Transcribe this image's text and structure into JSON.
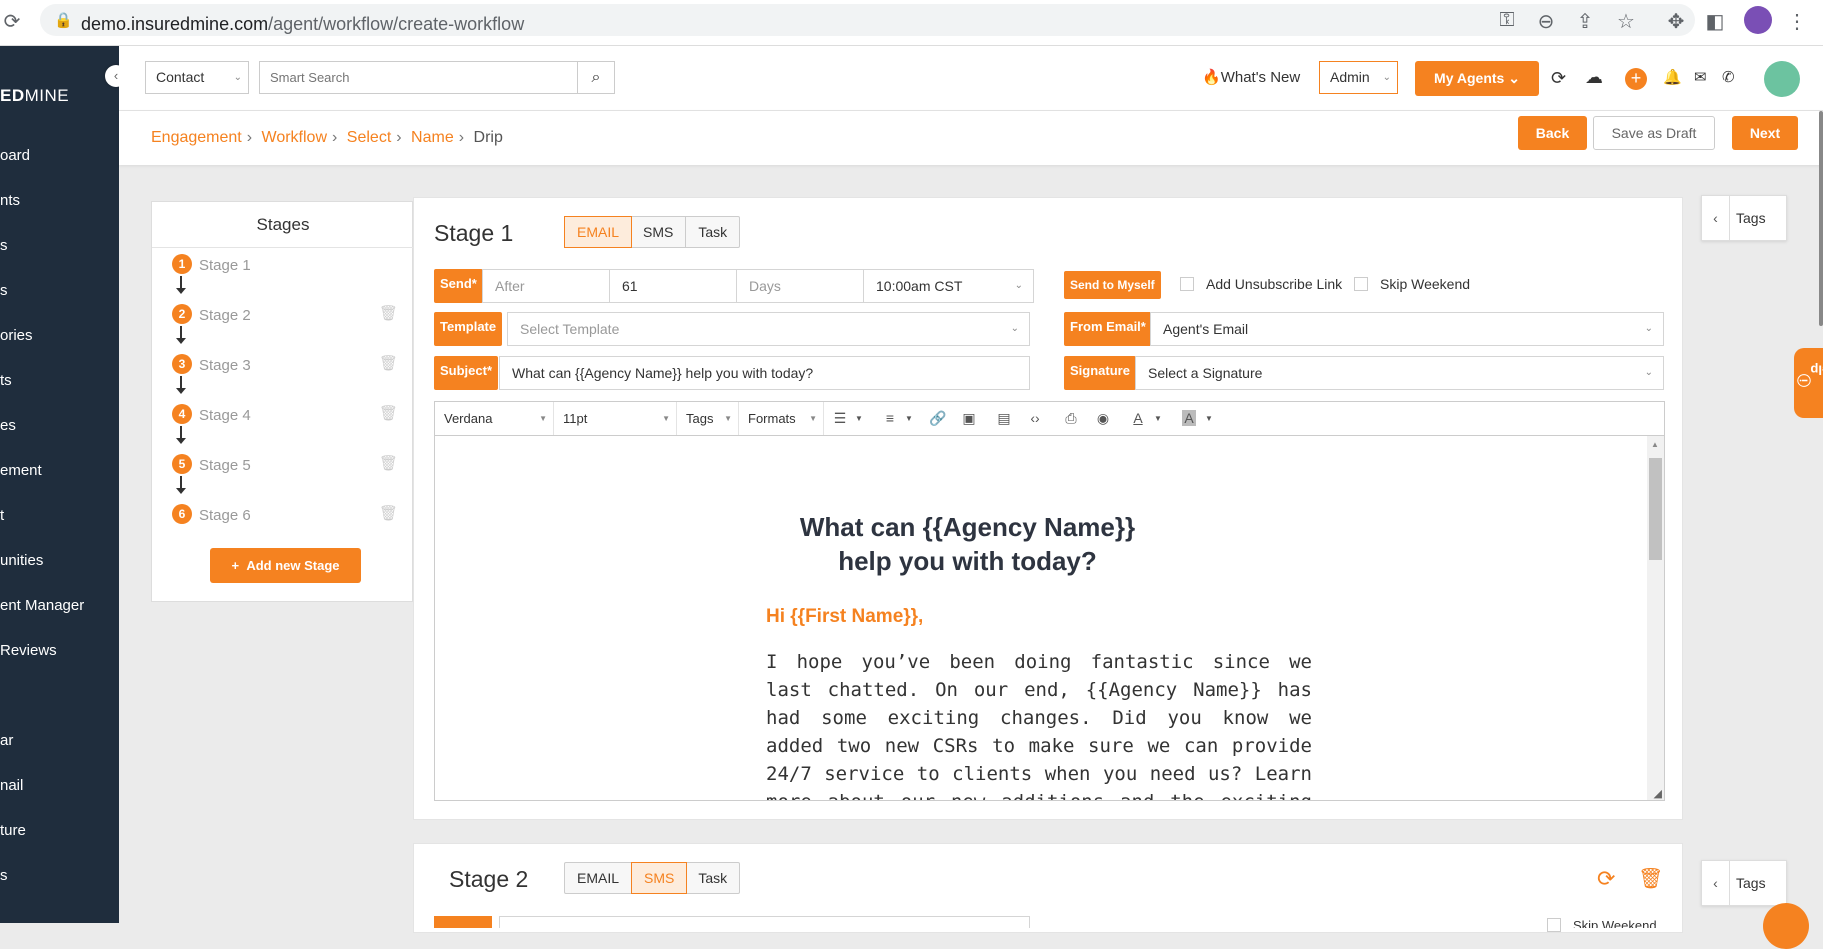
{
  "browser": {
    "url_host": "demo.insuredmine.com",
    "url_path": "/agent/workflow/create-workflow"
  },
  "sidebar": {
    "logo_bold": "ED",
    "logo_rest": "MINE",
    "items": [
      "oard",
      "nts",
      "s",
      "s",
      "ories",
      "ts",
      "es",
      "ement",
      "t",
      "unities",
      "ent Manager",
      "Reviews",
      "ar",
      "nail",
      "ture",
      "s"
    ]
  },
  "topbar": {
    "contact_select": "Contact",
    "search_placeholder": "Smart Search",
    "whats_new": "What's New",
    "admin_select": "Admin",
    "my_agents": "My Agents",
    "plus": "+"
  },
  "breadcrumb": {
    "items": [
      "Engagement",
      "Workflow",
      "Select",
      "Name"
    ],
    "current": "Drip"
  },
  "actions": {
    "back": "Back",
    "save_draft": "Save as Draft",
    "next": "Next"
  },
  "stages_panel": {
    "title": "Stages",
    "stages": [
      {
        "num": "1",
        "name": "Stage 1"
      },
      {
        "num": "2",
        "name": "Stage 2"
      },
      {
        "num": "3",
        "name": "Stage 3"
      },
      {
        "num": "4",
        "name": "Stage 4"
      },
      {
        "num": "5",
        "name": "Stage 5"
      },
      {
        "num": "6",
        "name": "Stage 6"
      }
    ],
    "add_button": "Add new Stage",
    "add_icon": "+"
  },
  "stage1": {
    "title": "Stage 1",
    "tabs": [
      "EMAIL",
      "SMS",
      "Task"
    ],
    "active_tab": "EMAIL",
    "send_label": "Send*",
    "after_placeholder": "After",
    "days_value": "61",
    "days_label": "Days",
    "time_value": "10:00am CST",
    "send_to_myself": "Send to Myself",
    "add_unsubscribe": "Add Unsubscribe Link",
    "skip_weekend": "Skip Weekend",
    "template_label": "Template",
    "template_placeholder": "Select Template",
    "from_email_label": "From Email*",
    "from_email_value": "Agent's Email",
    "subject_label": "Subject*",
    "subject_value": "What can {{Agency Name}} help you with today?",
    "signature_label": "Signature",
    "signature_value": "Select a Signature"
  },
  "toolbar": {
    "font": "Verdana",
    "size": "11pt",
    "tags": "Tags",
    "formats": "Formats",
    "text_color_letter": "A",
    "bg_color_letter": "A"
  },
  "editor": {
    "title": "What can {{Agency Name}} help you with today?",
    "greeting": "Hi {{First Name}},",
    "body": "I hope you’ve been doing fantastic since we last chatted. On our end, {{Agency Name}} has had some exciting changes. Did you know we added two new CSRs to make sure we can provide 24/7 service to clients when you need us? Learn more about our new additions and the exciting ways. This is"
  },
  "stage2": {
    "title": "Stage 2",
    "tabs": [
      "EMAIL",
      "SMS",
      "Task"
    ],
    "active_tab": "SMS",
    "skip_weekend": "Skip Weekend"
  },
  "tags_label": "Tags",
  "help_label": "Help",
  "colors": {
    "accent": "#f58220",
    "sidebar": "#1f2d3d"
  }
}
